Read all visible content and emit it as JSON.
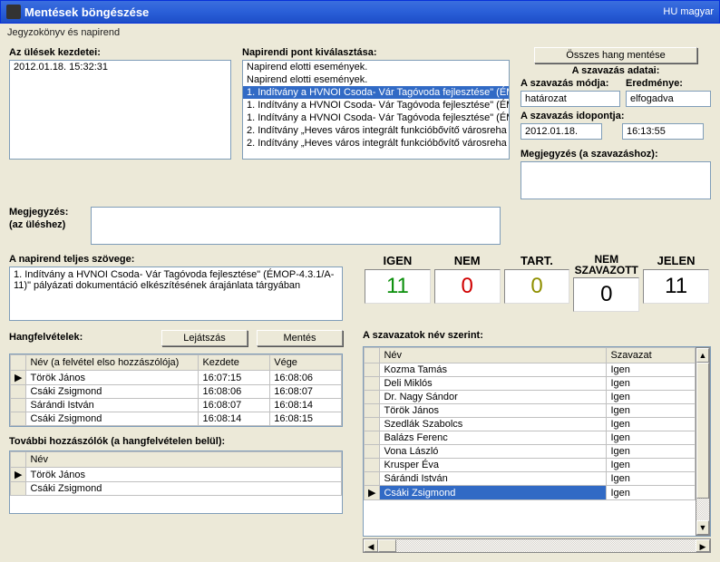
{
  "titlebar": {
    "title": "Mentések böngészése",
    "lang": "HU magyar"
  },
  "subtitle": "Jegyzokönyv és napirend",
  "sessions": {
    "label": "Az ülések kezdetei:",
    "items": [
      "2012.01.18.  15:32:31"
    ]
  },
  "agenda": {
    "label": "Napirendi pont kiválasztása:",
    "items": [
      "Napirend elotti események.",
      "Napirend elotti események.",
      "1. Indítvány a HVNOI Csoda- Vár Tagóvoda fejlesztése\" (ÉM",
      "1. Indítvány a HVNOI Csoda- Vár Tagóvoda fejlesztése\" (ÉM",
      "1. Indítvány a HVNOI Csoda- Vár Tagóvoda fejlesztése\" (ÉM",
      "2. Indítvány „Heves város integrált funkcióbővítő városreha",
      "2. Indítvány „Heves város integrált funkcióbővítő városreha"
    ],
    "selectedIndex": 2
  },
  "topbtn": "Összes hang mentése",
  "voteinfo": {
    "header": "A szavazás adatai:",
    "modeLabel": "A szavazás módja:",
    "modeValue": "határozat",
    "resultLabel": "Eredménye:",
    "resultValue": "elfogadva",
    "timeLabel": "A szavazás idopontja:",
    "date": "2012.01.18.",
    "time": "16:13:55"
  },
  "note1": {
    "label1": "Megjegyzés:",
    "label2": "(az üléshez)",
    "value": ""
  },
  "note2": {
    "label": "Megjegyzés (a szavazáshoz):",
    "value": ""
  },
  "fulltext": {
    "label": "A napirend teljes szövege:",
    "value": "1. Indítvány a HVNOI Csoda- Vár Tagóvoda fejlesztése\" (ÉMOP-4.3.1/A-11)\" pályázati dokumentáció elkészítésének árajánlata tárgyában"
  },
  "votes": {
    "labels": {
      "igen": "IGEN",
      "nem": "NEM",
      "tart": "TART.",
      "nemsz1": "NEM",
      "nemsz2": "SZAVAZOTT",
      "jelen": "JELEN"
    },
    "values": {
      "igen": "11",
      "nem": "0",
      "tart": "0",
      "nemsz": "0",
      "jelen": "11"
    },
    "colors": {
      "igen": "#0B8F0B",
      "nem": "#D00000",
      "tart": "#8F8F00",
      "nemsz": "#000",
      "jelen": "#000"
    }
  },
  "recordings": {
    "label": "Hangfelvételek:",
    "playBtn": "Lejátszás",
    "saveBtn": "Mentés",
    "headers": [
      "Név (a felvétel elso hozzászólója)",
      "Kezdete",
      "Vége"
    ],
    "rows": [
      {
        "arrow": true,
        "name": "Török János",
        "start": "16:07:15",
        "end": "16:08:06"
      },
      {
        "arrow": false,
        "name": "Csáki Zsigmond",
        "start": "16:08:06",
        "end": "16:08:07"
      },
      {
        "arrow": false,
        "name": "Sárándi István",
        "start": "16:08:07",
        "end": "16:08:14"
      },
      {
        "arrow": false,
        "name": "Csáki Zsigmond",
        "start": "16:08:14",
        "end": "16:08:15"
      }
    ]
  },
  "speakers": {
    "label": "További hozzászólók (a hangfelvételen belül):",
    "header": "Név",
    "rows": [
      {
        "arrow": true,
        "name": "Török János"
      },
      {
        "arrow": false,
        "name": "Csáki Zsigmond"
      }
    ]
  },
  "byname": {
    "label": "A szavazatok név szerint:",
    "headers": [
      "Név",
      "Szavazat"
    ],
    "rows": [
      {
        "name": "Kozma Tamás",
        "vote": "Igen"
      },
      {
        "name": "Deli Miklós",
        "vote": "Igen"
      },
      {
        "name": "Dr. Nagy Sándor",
        "vote": "Igen"
      },
      {
        "name": "Török János",
        "vote": "Igen"
      },
      {
        "name": "Szedlák Szabolcs",
        "vote": "Igen"
      },
      {
        "name": "Balázs Ferenc",
        "vote": "Igen"
      },
      {
        "name": "Vona László",
        "vote": "Igen"
      },
      {
        "name": "Krusper Éva",
        "vote": "Igen"
      },
      {
        "name": "Sárándi István",
        "vote": "Igen"
      },
      {
        "name": "Csáki Zsigmond",
        "vote": "Igen",
        "selected": true
      }
    ]
  }
}
